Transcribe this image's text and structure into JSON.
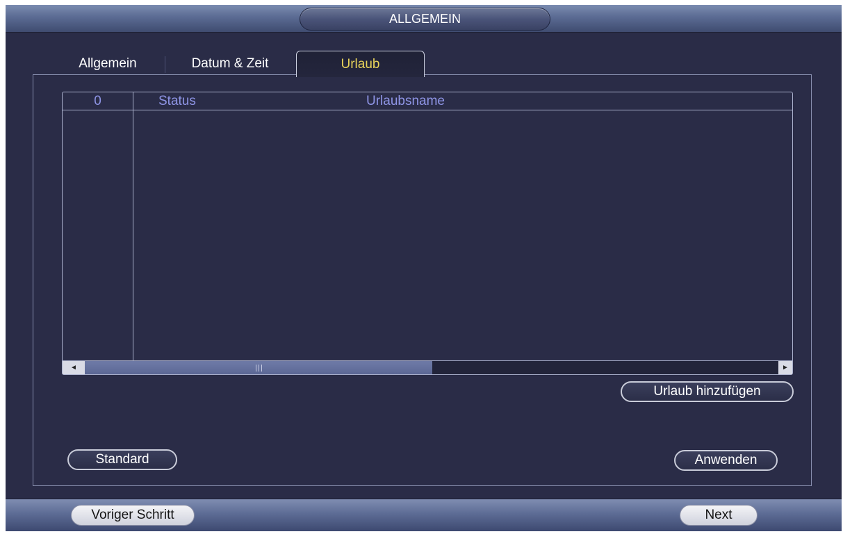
{
  "header": {
    "title": "ALLGEMEIN"
  },
  "tabs": [
    {
      "label": "Allgemein"
    },
    {
      "label": "Datum & Zeit"
    },
    {
      "label": "Urlaub",
      "active": true
    }
  ],
  "table": {
    "columns": [
      "0",
      "Status",
      "Urlaubsname"
    ],
    "rows": []
  },
  "scrollbar": {
    "left_arrow": "◄",
    "right_arrow": "►"
  },
  "buttons": {
    "add_holiday": "Urlaub hinzufügen",
    "default": "Standard",
    "apply": "Anwenden"
  },
  "footer": {
    "prev": "Voriger Schritt",
    "next": "Next"
  },
  "colors": {
    "background": "#2a2c47",
    "active_tab_text": "#e8d35a",
    "table_header_text": "#8f95e6"
  }
}
